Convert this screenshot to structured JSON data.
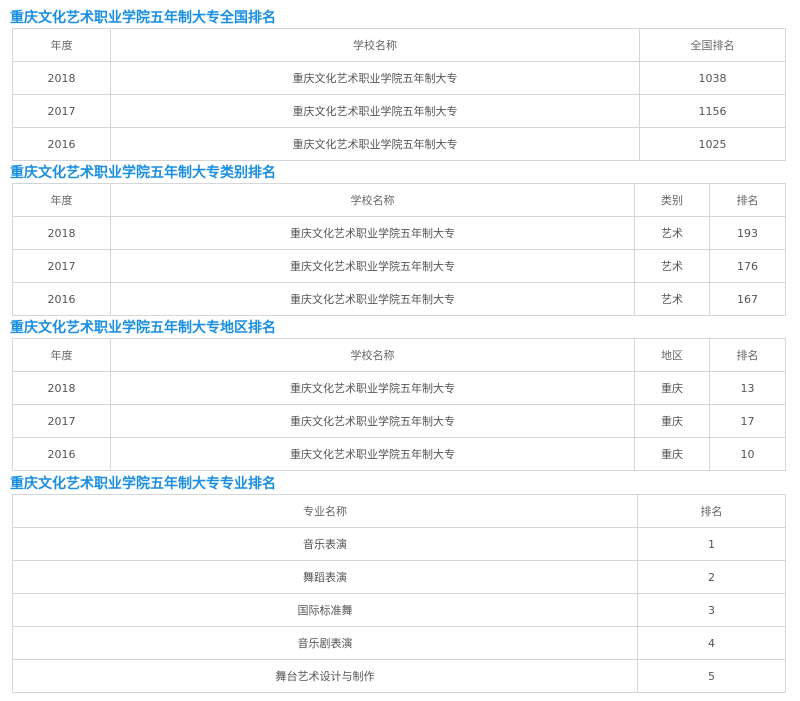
{
  "national": {
    "title": "重庆文化艺术职业学院五年制大专全国排名",
    "headers": [
      "年度",
      "学校名称",
      "全国排名"
    ],
    "rows": [
      [
        "2018",
        "重庆文化艺术职业学院五年制大专",
        "1038"
      ],
      [
        "2017",
        "重庆文化艺术职业学院五年制大专",
        "1156"
      ],
      [
        "2016",
        "重庆文化艺术职业学院五年制大专",
        "1025"
      ]
    ]
  },
  "category": {
    "title": "重庆文化艺术职业学院五年制大专类别排名",
    "headers": [
      "年度",
      "学校名称",
      "类别",
      "排名"
    ],
    "rows": [
      [
        "2018",
        "重庆文化艺术职业学院五年制大专",
        "艺术",
        "193"
      ],
      [
        "2017",
        "重庆文化艺术职业学院五年制大专",
        "艺术",
        "176"
      ],
      [
        "2016",
        "重庆文化艺术职业学院五年制大专",
        "艺术",
        "167"
      ]
    ]
  },
  "region": {
    "title": "重庆文化艺术职业学院五年制大专地区排名",
    "headers": [
      "年度",
      "学校名称",
      "地区",
      "排名"
    ],
    "rows": [
      [
        "2018",
        "重庆文化艺术职业学院五年制大专",
        "重庆",
        "13"
      ],
      [
        "2017",
        "重庆文化艺术职业学院五年制大专",
        "重庆",
        "17"
      ],
      [
        "2016",
        "重庆文化艺术职业学院五年制大专",
        "重庆",
        "10"
      ]
    ]
  },
  "major": {
    "title": "重庆文化艺术职业学院五年制大专专业排名",
    "headers": [
      "专业名称",
      "排名"
    ],
    "rows": [
      [
        "音乐表演",
        "1"
      ],
      [
        "舞蹈表演",
        "2"
      ],
      [
        "国际标准舞",
        "3"
      ],
      [
        "音乐剧表演",
        "4"
      ],
      [
        "舞台艺术设计与制作",
        "5"
      ]
    ]
  }
}
